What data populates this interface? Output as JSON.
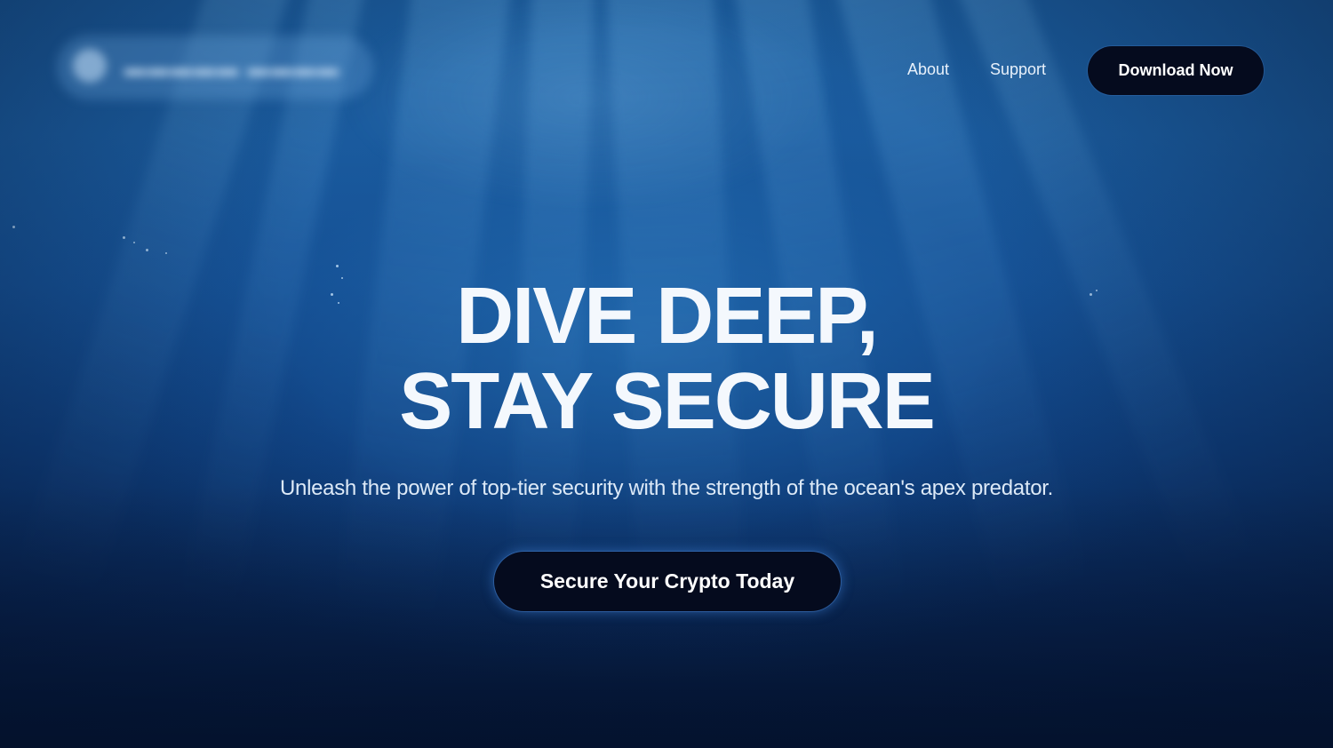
{
  "nav": {
    "links": [
      {
        "label": "About"
      },
      {
        "label": "Support"
      }
    ],
    "download_label": "Download Now"
  },
  "hero": {
    "title_line1": "DIVE DEEP,",
    "title_line2": "STAY SECURE",
    "subtitle": "Unleash the power of top-tier security with the strength of the ocean's apex predator.",
    "cta_label": "Secure Your Crypto Today"
  },
  "colors": {
    "background_top": "#1a5a9a",
    "background_bottom": "#061a3e",
    "button": "#050b1e",
    "text": "#f4f8fd"
  }
}
